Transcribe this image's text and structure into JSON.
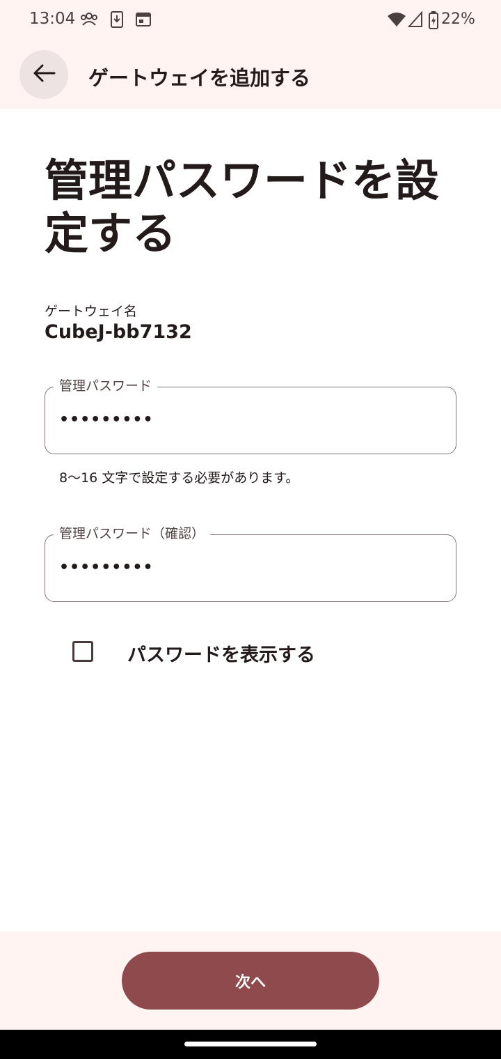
{
  "status_bar": {
    "time": "13:04",
    "battery_percent": "22%",
    "icons": [
      "people-icon",
      "download-icon",
      "calendar-icon",
      "wifi-icon",
      "signal-icon",
      "battery-charging-icon"
    ]
  },
  "app_bar": {
    "back_icon": "arrow-back-icon",
    "title": "ゲートウェイを追加する"
  },
  "main": {
    "heading": "管理パスワードを設定する",
    "gateway_name_label": "ゲートウェイ名",
    "gateway_name_value": "CubeJ-bb7132",
    "password_field": {
      "label": "管理パスワード",
      "value": "•••••••••"
    },
    "helper_text": "8～16 文字で設定する必要があります。",
    "confirm_field": {
      "label": "管理パスワード（確認）",
      "value": "•••••••••"
    },
    "show_password": {
      "label": "パスワードを表示する",
      "checked": false
    }
  },
  "footer": {
    "next_label": "次へ"
  },
  "colors": {
    "accent": "#8e4a4d",
    "surface": "#fff4f2",
    "text": "#231a1a",
    "outline": "#857373"
  }
}
